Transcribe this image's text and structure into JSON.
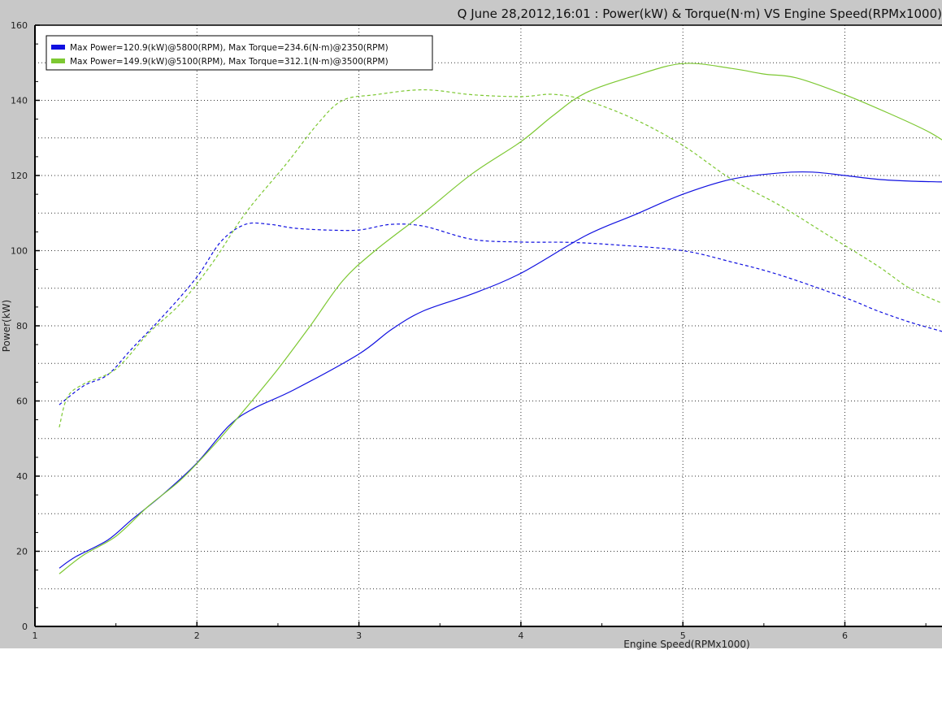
{
  "chart_data": {
    "type": "line",
    "title": "Q June 28,2012,16:01  : Power(kW) & Torque(N·m) VS Engine Speed(RPMx1000)",
    "xlabel": "Engine Speed(RPMx1000)",
    "ylabel": "Power(kW)",
    "xlim": [
      1,
      6.6
    ],
    "ylim": [
      0,
      160
    ],
    "x_ticks": [
      1,
      2,
      3,
      4,
      5,
      6
    ],
    "y_ticks": [
      0,
      20,
      40,
      60,
      80,
      100,
      120,
      140,
      160
    ],
    "grid": true,
    "legend_position": "top-left",
    "series": [
      {
        "name": "Max Power=120.9(kW)@5800(RPM), Max Torque=234.6(N·m)@2350(RPM)",
        "color": "#1010e0",
        "style": "solid",
        "x": [
          1.15,
          1.25,
          1.45,
          1.6,
          1.8,
          2.0,
          2.2,
          2.35,
          2.6,
          3.0,
          3.2,
          3.4,
          3.7,
          4.0,
          4.4,
          4.7,
          5.0,
          5.3,
          5.6,
          5.8,
          6.0,
          6.2,
          6.4,
          6.6
        ],
        "values": [
          15.5,
          18.5,
          23,
          28.5,
          35.5,
          43.5,
          53.5,
          58,
          63,
          72.5,
          79,
          84,
          88.5,
          94,
          104,
          109.5,
          115,
          119,
          120.7,
          120.9,
          120,
          119,
          118.5,
          118.3
        ]
      },
      {
        "name": "",
        "color": "#1010e0",
        "style": "dashed",
        "x": [
          1.15,
          1.3,
          1.45,
          1.6,
          1.8,
          2.0,
          2.15,
          2.3,
          2.45,
          2.6,
          2.8,
          3.0,
          3.2,
          3.4,
          3.7,
          4.0,
          4.3,
          4.6,
          5.0,
          5.3,
          5.6,
          6.0,
          6.2,
          6.4,
          6.6
        ],
        "values": [
          59,
          64,
          67,
          74,
          83,
          93,
          102.5,
          107,
          107,
          106,
          105.5,
          105.5,
          107,
          106.5,
          103,
          102.3,
          102.2,
          101.5,
          100,
          97,
          93.5,
          87.5,
          84,
          81,
          78.5
        ]
      },
      {
        "name": "Max Power=149.9(kW)@5100(RPM), Max Torque=312.1(N·m)@3500(RPM)",
        "color": "#7dc832",
        "style": "solid",
        "x": [
          1.15,
          1.3,
          1.5,
          1.7,
          1.9,
          2.1,
          2.3,
          2.5,
          2.7,
          2.9,
          3.1,
          3.4,
          3.7,
          4.0,
          4.2,
          4.4,
          4.7,
          5.0,
          5.3,
          5.5,
          5.7,
          6.0,
          6.3,
          6.5,
          6.6
        ],
        "values": [
          14,
          19,
          24,
          32,
          39,
          48,
          58,
          68.5,
          80,
          92,
          100,
          110,
          120.5,
          129,
          136,
          142,
          146.5,
          149.8,
          148.5,
          147,
          146,
          141.5,
          136,
          132,
          129.5
        ]
      },
      {
        "name": "",
        "color": "#7dc832",
        "style": "dashed",
        "x": [
          1.15,
          1.2,
          1.3,
          1.5,
          1.7,
          1.9,
          2.1,
          2.3,
          2.55,
          2.75,
          2.9,
          3.1,
          3.4,
          3.7,
          4.0,
          4.2,
          4.4,
          4.7,
          5.0,
          5.3,
          5.6,
          5.9,
          6.2,
          6.4,
          6.6
        ],
        "values": [
          53,
          61,
          64.5,
          68.5,
          78,
          86,
          97,
          110,
          123,
          134,
          140,
          141.5,
          142.8,
          141.5,
          141,
          141.6,
          140,
          135,
          128,
          119,
          112,
          104,
          96,
          90,
          86
        ]
      }
    ]
  }
}
